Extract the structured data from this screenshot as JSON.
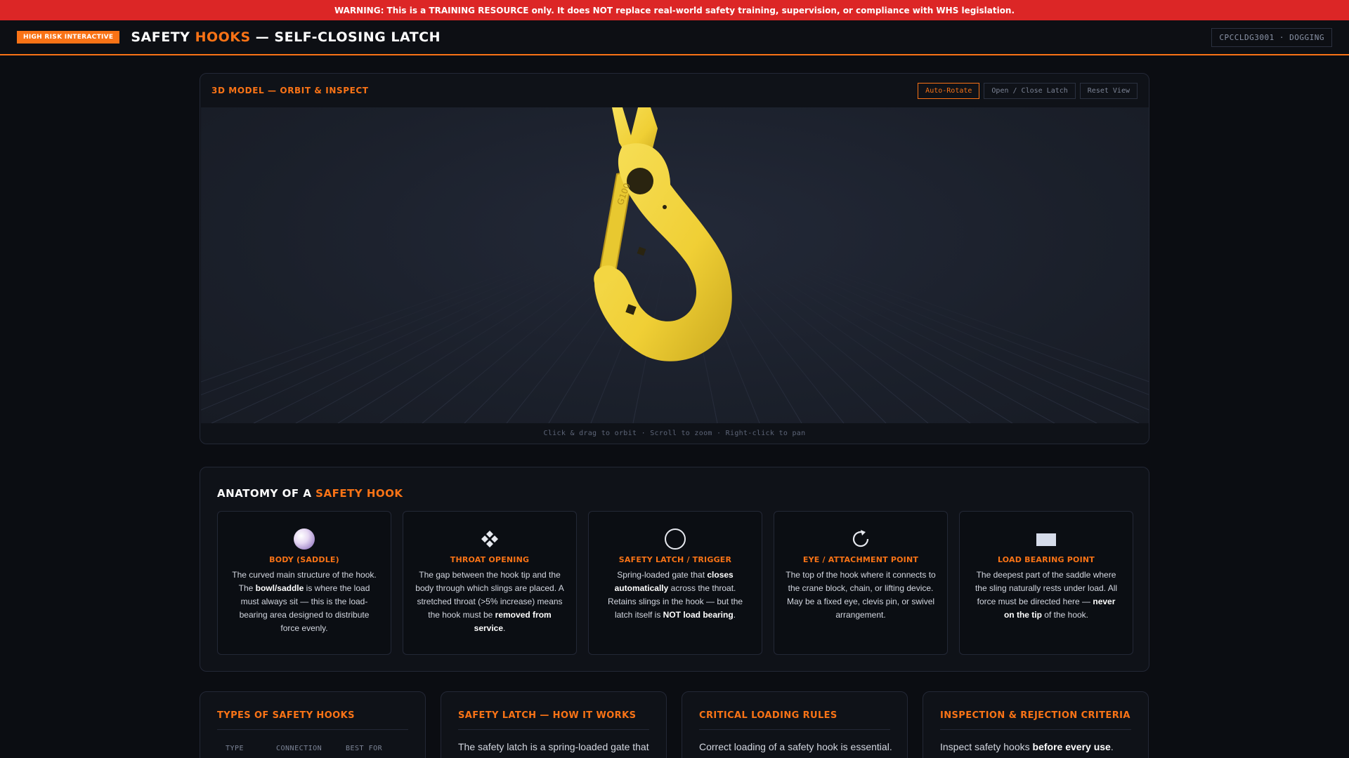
{
  "warning": "WARNING: This is a TRAINING RESOURCE only. It does NOT replace real-world safety training, supervision, or compliance with WHS legislation.",
  "header": {
    "badge": "HIGH RISK INTERACTIVE",
    "title_a": "SAFETY ",
    "title_accent": "HOOKS",
    "title_b": " — SELF-CLOSING LATCH",
    "course": "CPCCLDG3001 · DOGGING"
  },
  "viewer": {
    "title": "3D MODEL — ORBIT & INSPECT",
    "controls": [
      "Auto-Rotate",
      "Open / Close Latch",
      "Reset View"
    ],
    "active_control": "Auto-Rotate",
    "hint": "Click & drag to orbit · Scroll to zoom · Right-click to pan",
    "model_colors": {
      "hook": "#f2d43c",
      "hook_shade": "#c9a81e",
      "marking": "#2a2410"
    },
    "model_marking": "G100"
  },
  "anatomy": {
    "title_a": "ANATOMY OF A ",
    "title_accent": "SAFETY HOOK",
    "cards": [
      {
        "icon": "sphere-icon",
        "title": "BODY (SADDLE)",
        "desc_pre": "The curved main structure of the hook. The ",
        "bold": "bowl/saddle",
        "desc_post": " is where the load must always sit — this is the load-bearing area designed to distribute force evenly."
      },
      {
        "icon": "diamond-cluster-icon",
        "title": "THROAT OPENING",
        "desc_pre": "The gap between the hook tip and the body through which slings are placed. A stretched throat (>5% increase) means the hook must be ",
        "bold": "removed from service",
        "desc_post": "."
      },
      {
        "icon": "circle-icon",
        "title": "SAFETY LATCH / TRIGGER",
        "desc_pre": "Spring-loaded gate that ",
        "bold": "closes automatically",
        "desc_mid": " across the throat. Retains slings in the hook — but the latch itself is ",
        "bold2": "NOT load bearing",
        "desc_post": "."
      },
      {
        "icon": "rotate-icon",
        "title": "EYE / ATTACHMENT POINT",
        "desc_pre": "The top of the hook where it connects to the crane block, chain, or lifting device. May be a fixed eye, clevis pin, or swivel arrangement.",
        "bold": "",
        "desc_post": ""
      },
      {
        "icon": "rectangle-icon",
        "title": "LOAD BEARING POINT",
        "desc_pre": "The deepest part of the saddle where the sling naturally rests under load. All force must be directed here — ",
        "bold": "never on the tip",
        "desc_post": " of the hook."
      }
    ]
  },
  "bottom": {
    "types": {
      "title": "TYPES OF SAFETY HOOKS",
      "columns": [
        "TYPE",
        "CONNECTION",
        "BEST FOR"
      ]
    },
    "latch": {
      "title": "SAFETY LATCH — HOW IT WORKS",
      "text": "The safety latch is a spring-loaded gate that"
    },
    "loading": {
      "title": "CRITICAL LOADING RULES",
      "text": "Correct loading of a safety hook is essential."
    },
    "inspection": {
      "title": "INSPECTION & REJECTION CRITERIA",
      "text_pre": "Inspect safety hooks ",
      "text_bold": "before every use",
      "text_post": "."
    }
  }
}
